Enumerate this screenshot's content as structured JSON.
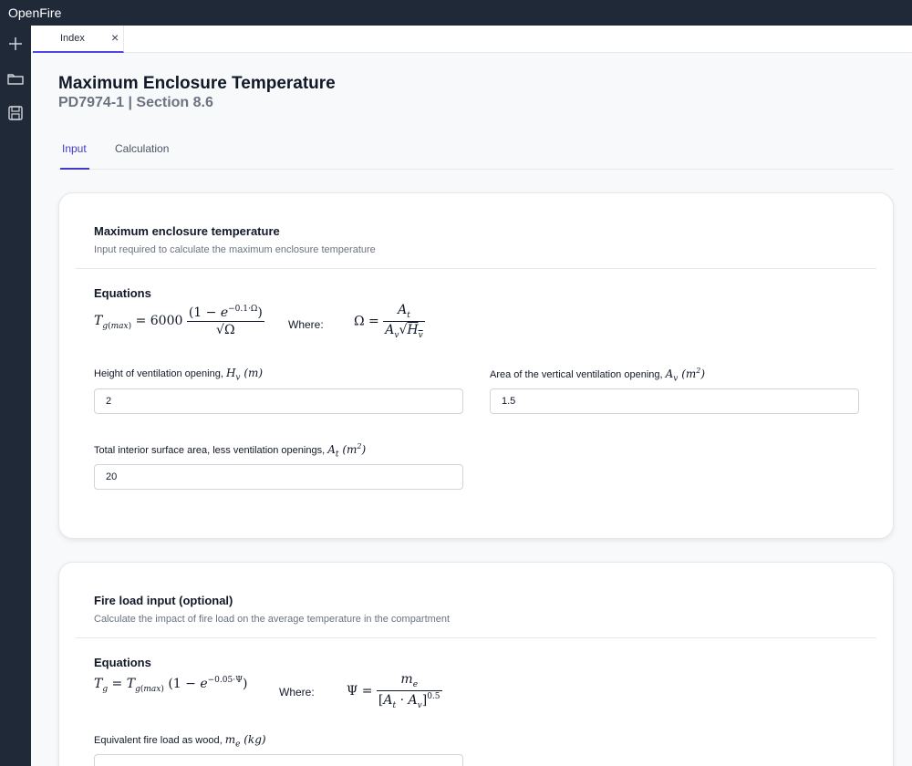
{
  "app": {
    "title": "OpenFire"
  },
  "sidebar": {
    "icons": [
      "plus-icon",
      "folder-icon",
      "save-icon"
    ]
  },
  "file_tab": {
    "label": "Index",
    "close": "×"
  },
  "page": {
    "title": "Maximum Enclosure Temperature",
    "subtitle": "PD7974-1 | Section 8.6"
  },
  "tabs": [
    {
      "label": "Input",
      "active": true
    },
    {
      "label": "Calculation",
      "active": false
    }
  ],
  "section1": {
    "title": "Maximum enclosure temperature",
    "description": "Input required to calculate the maximum enclosure temperature",
    "equations_heading": "Equations",
    "equation_main": "Tg(max) = 6000 (1 − e^(−0.1·Ω)) / √Ω",
    "where": "Where:",
    "equation_where": "Ω = At / (Av √Hv)",
    "fields": {
      "hv": {
        "label": "Height of ventilation opening, ",
        "symbol": "Hv (m)",
        "value": "2"
      },
      "av": {
        "label": "Area of the vertical ventilation opening, ",
        "symbol": "Av (m²)",
        "value": "1.5"
      },
      "at": {
        "label": "Total interior surface area, less ventilation openings, ",
        "symbol": "At (m²)",
        "value": "20"
      }
    }
  },
  "section2": {
    "title": "Fire load input (optional)",
    "description": "Calculate the impact of fire load on the average temperature in the compartment",
    "equations_heading": "Equations",
    "equation_main": "Tg = Tg(max) (1 − e^(−0.05·Ψ))",
    "where": "Where:",
    "equation_where": "Ψ = me / [At · Av]^0.5",
    "fields": {
      "me": {
        "label": "Equivalent fire load as wood, ",
        "symbol": "me (kg)",
        "value": ""
      }
    }
  },
  "colors": {
    "dark": "#1f2937",
    "accent": "#4338ca",
    "muted": "#6b7280",
    "border": "#e5e7eb"
  }
}
